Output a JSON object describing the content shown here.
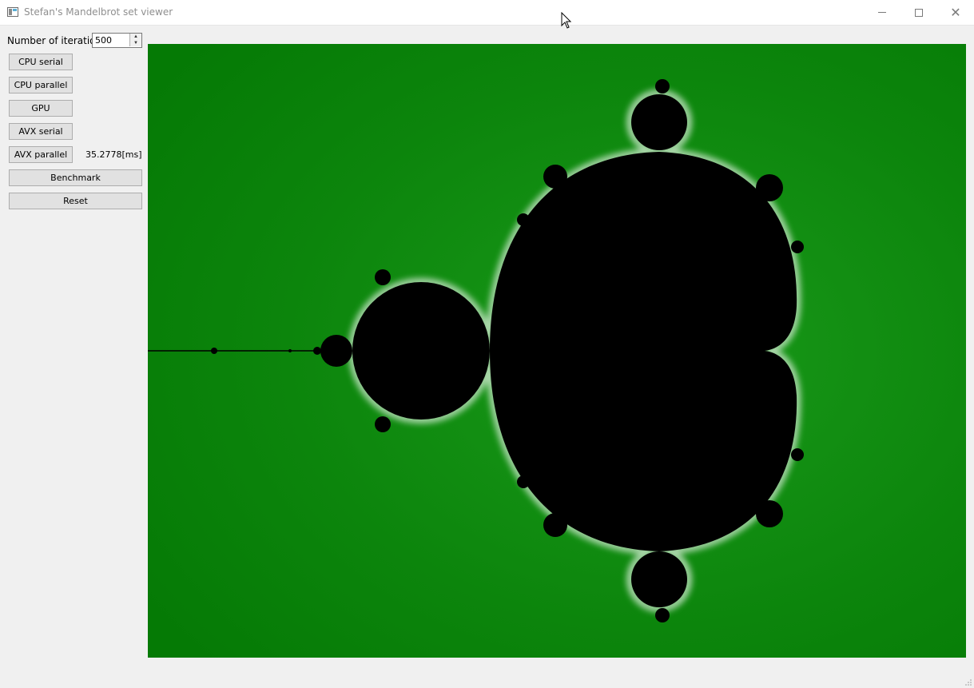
{
  "window": {
    "title": "Stefan's Mandelbrot set viewer",
    "icon": "app-window-icon",
    "controls": [
      "minimize-icon",
      "maximize-icon",
      "close-icon"
    ]
  },
  "panel": {
    "iterations_label": "Number of iterations",
    "iterations_value": "500",
    "buttons": {
      "cpu_serial": "CPU serial",
      "cpu_parallel": "CPU parallel",
      "gpu": "GPU",
      "avx_serial": "AVX serial",
      "avx_parallel": "AVX parallel",
      "benchmark": "Benchmark",
      "reset": "Reset"
    },
    "timing": "35.2778[ms]"
  },
  "colors": {
    "background_green": "#0a7d0a",
    "set_black": "#000000",
    "edge_white": "#dfeedf"
  }
}
